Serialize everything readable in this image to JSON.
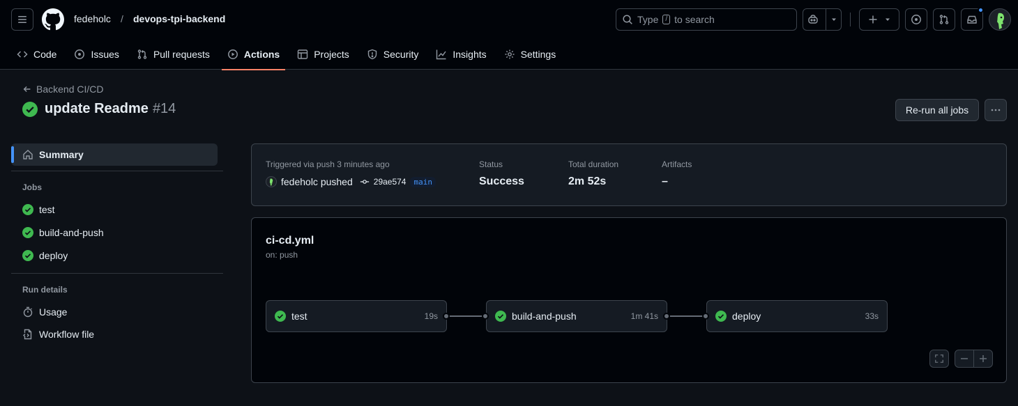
{
  "header": {
    "owner": "fedeholc",
    "separator": "/",
    "repo": "devops-tpi-backend",
    "search": {
      "prefix": "Type",
      "key": "/",
      "suffix": "to search"
    }
  },
  "nav": {
    "tabs": [
      {
        "label": "Code",
        "icon": "code-icon"
      },
      {
        "label": "Issues",
        "icon": "issue-icon"
      },
      {
        "label": "Pull requests",
        "icon": "pull-request-icon"
      },
      {
        "label": "Actions",
        "icon": "play-icon",
        "active": true
      },
      {
        "label": "Projects",
        "icon": "table-icon"
      },
      {
        "label": "Security",
        "icon": "shield-icon"
      },
      {
        "label": "Insights",
        "icon": "graph-icon"
      },
      {
        "label": "Settings",
        "icon": "gear-icon"
      }
    ]
  },
  "run": {
    "workflow_back": "Backend CI/CD",
    "title": "update Readme",
    "number": "#14",
    "rerun_label": "Re-run all jobs"
  },
  "sidebar": {
    "summary_label": "Summary",
    "jobs_heading": "Jobs",
    "jobs": [
      "test",
      "build-and-push",
      "deploy"
    ],
    "run_details_heading": "Run details",
    "details": [
      {
        "label": "Usage",
        "icon": "stopwatch-icon"
      },
      {
        "label": "Workflow file",
        "icon": "file-code-icon"
      }
    ]
  },
  "summary": {
    "trigger_label": "Triggered via push 3 minutes ago",
    "actor_text": "fedeholc pushed",
    "commit": "29ae574",
    "branch": "main",
    "status_label": "Status",
    "status_value": "Success",
    "duration_label": "Total duration",
    "duration_value": "2m 52s",
    "artifacts_label": "Artifacts",
    "artifacts_value": "–"
  },
  "graph": {
    "file": "ci-cd.yml",
    "trigger": "on: push",
    "jobs": [
      {
        "name": "test",
        "duration": "19s"
      },
      {
        "name": "build-and-push",
        "duration": "1m 41s"
      },
      {
        "name": "deploy",
        "duration": "33s"
      }
    ]
  },
  "colors": {
    "success": "#3fb950",
    "accent": "#f78166",
    "link": "#4493f8"
  }
}
